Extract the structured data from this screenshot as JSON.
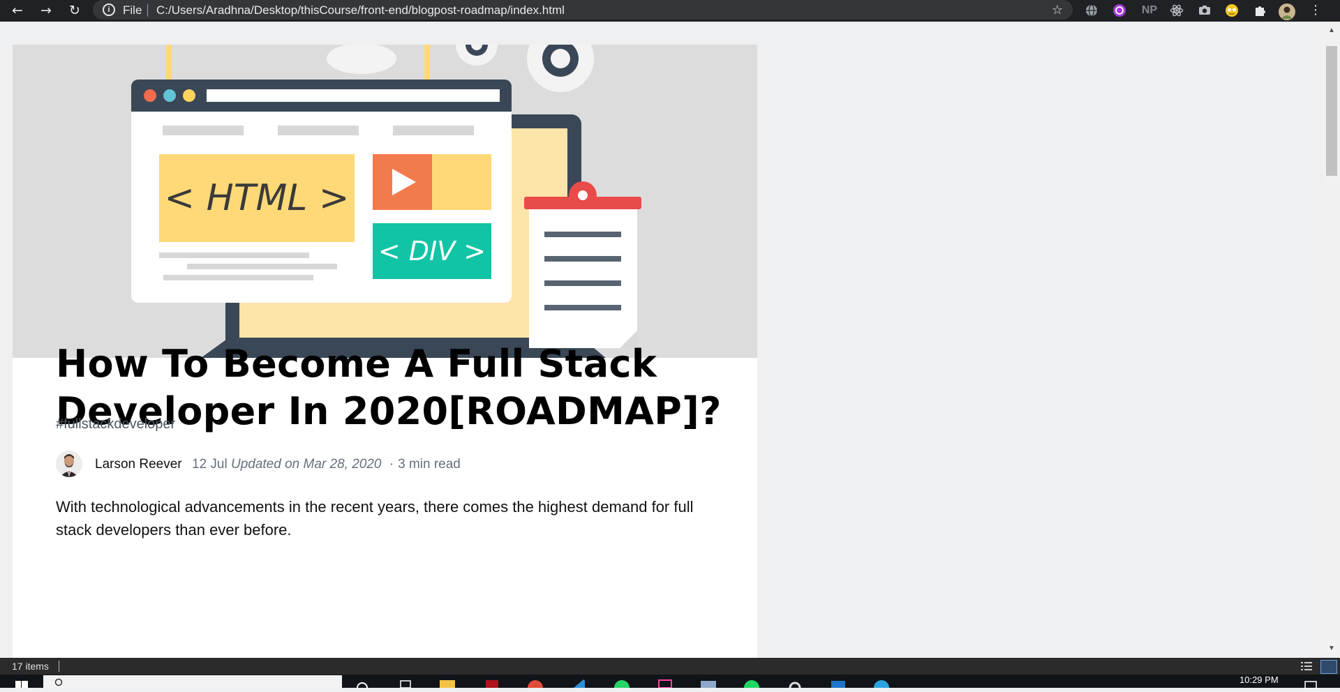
{
  "browser": {
    "scheme_label": "File",
    "url": "C:/Users/Aradhna/Desktop/thisCourse/front-end/blogpost-roadmap/index.html",
    "extensions": [
      "globe-icon",
      "purple-extension-icon",
      "np-extension-icon",
      "react-devtools-icon",
      "camera-icon",
      "emoji-extension-icon",
      "puzzle-icon"
    ],
    "np_label": "NP"
  },
  "hero": {
    "html_label": "< HTML >",
    "div_label": "< DIV >"
  },
  "article": {
    "title": "How To Become A Full Stack Developer In 2020[ROADMAP]?",
    "tag": "#fullstackdeveloper",
    "author": "Larson Reever",
    "date": "12 Jul",
    "updated": "Updated on Mar 28, 2020",
    "read_sep": "·",
    "read_time": "3 min read",
    "intro": "With technological advancements in the recent years, there comes the highest demand for full stack developers than ever before."
  },
  "explorer": {
    "items_count": "17 items"
  },
  "taskbar": {
    "clock": "10:29 PM"
  },
  "colors": {
    "toolbar_bg": "#202124",
    "page_bg": "#eef0f2",
    "html_box": "#ffd978",
    "play_box": "#f27b4d",
    "div_box": "#11c4a5",
    "clipboard_clip": "#e94b4b",
    "laptop_frame": "#3a4756"
  }
}
